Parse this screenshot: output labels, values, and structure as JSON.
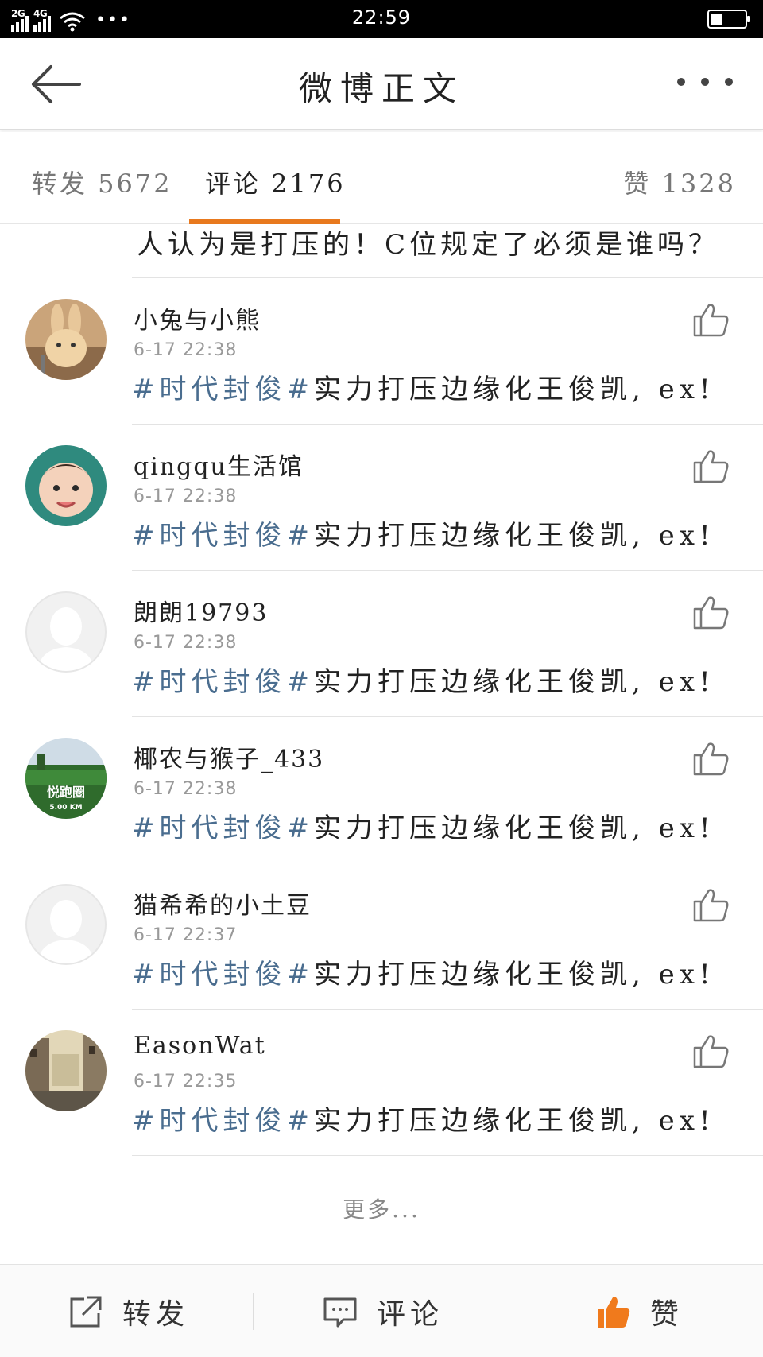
{
  "status_bar": {
    "network_1": "2G",
    "network_2": "4G",
    "dots": "•••",
    "time": "22:59",
    "battery_level": 0.35
  },
  "header": {
    "title": "微博正文",
    "back_icon": "back-arrow-icon",
    "more_icon": "more-dots-icon"
  },
  "tabs": {
    "forward": "转发 5672",
    "comment": "评论 2176",
    "like": "赞 1328",
    "active": "comment",
    "accent_color": "#e8791e"
  },
  "prev_text": "人认为是打压的！C位规定了必须是谁吗？",
  "comments": [
    {
      "username": "小兔与小熊",
      "time": "6-17 22:38",
      "topic": "#时代封俊#",
      "text": "实力打压边缘化王俊凯, ex!"
    },
    {
      "username": "qingqu生活馆",
      "time": "6-17 22:38",
      "topic": "#时代封俊#",
      "text": "实力打压边缘化王俊凯, ex!"
    },
    {
      "username": "朗朗19793",
      "time": "6-17 22:38",
      "topic": "#时代封俊#",
      "text": "实力打压边缘化王俊凯, ex!"
    },
    {
      "username": "椰农与猴子_433",
      "time": "6-17 22:38",
      "topic": "#时代封俊#",
      "text": "实力打压边缘化王俊凯, ex!"
    },
    {
      "username": "猫希希的小土豆",
      "time": "6-17 22:37",
      "topic": "#时代封俊#",
      "text": "实力打压边缘化王俊凯, ex!"
    },
    {
      "username": "EasonWat",
      "time": "6-17 22:35",
      "topic": "#时代封俊#",
      "text": "实力打压边缘化王俊凯, ex!"
    }
  ],
  "avatar_texts": {
    "run_title": "悦跑圈",
    "run_distance": "5.00 KM"
  },
  "more_link": "更多...",
  "bottom_bar": {
    "forward": "转发",
    "comment": "评论",
    "like": "赞",
    "like_color": "#f07a1c"
  },
  "colors": {
    "topic_link": "#4a6d8f",
    "accent": "#e8791e"
  }
}
